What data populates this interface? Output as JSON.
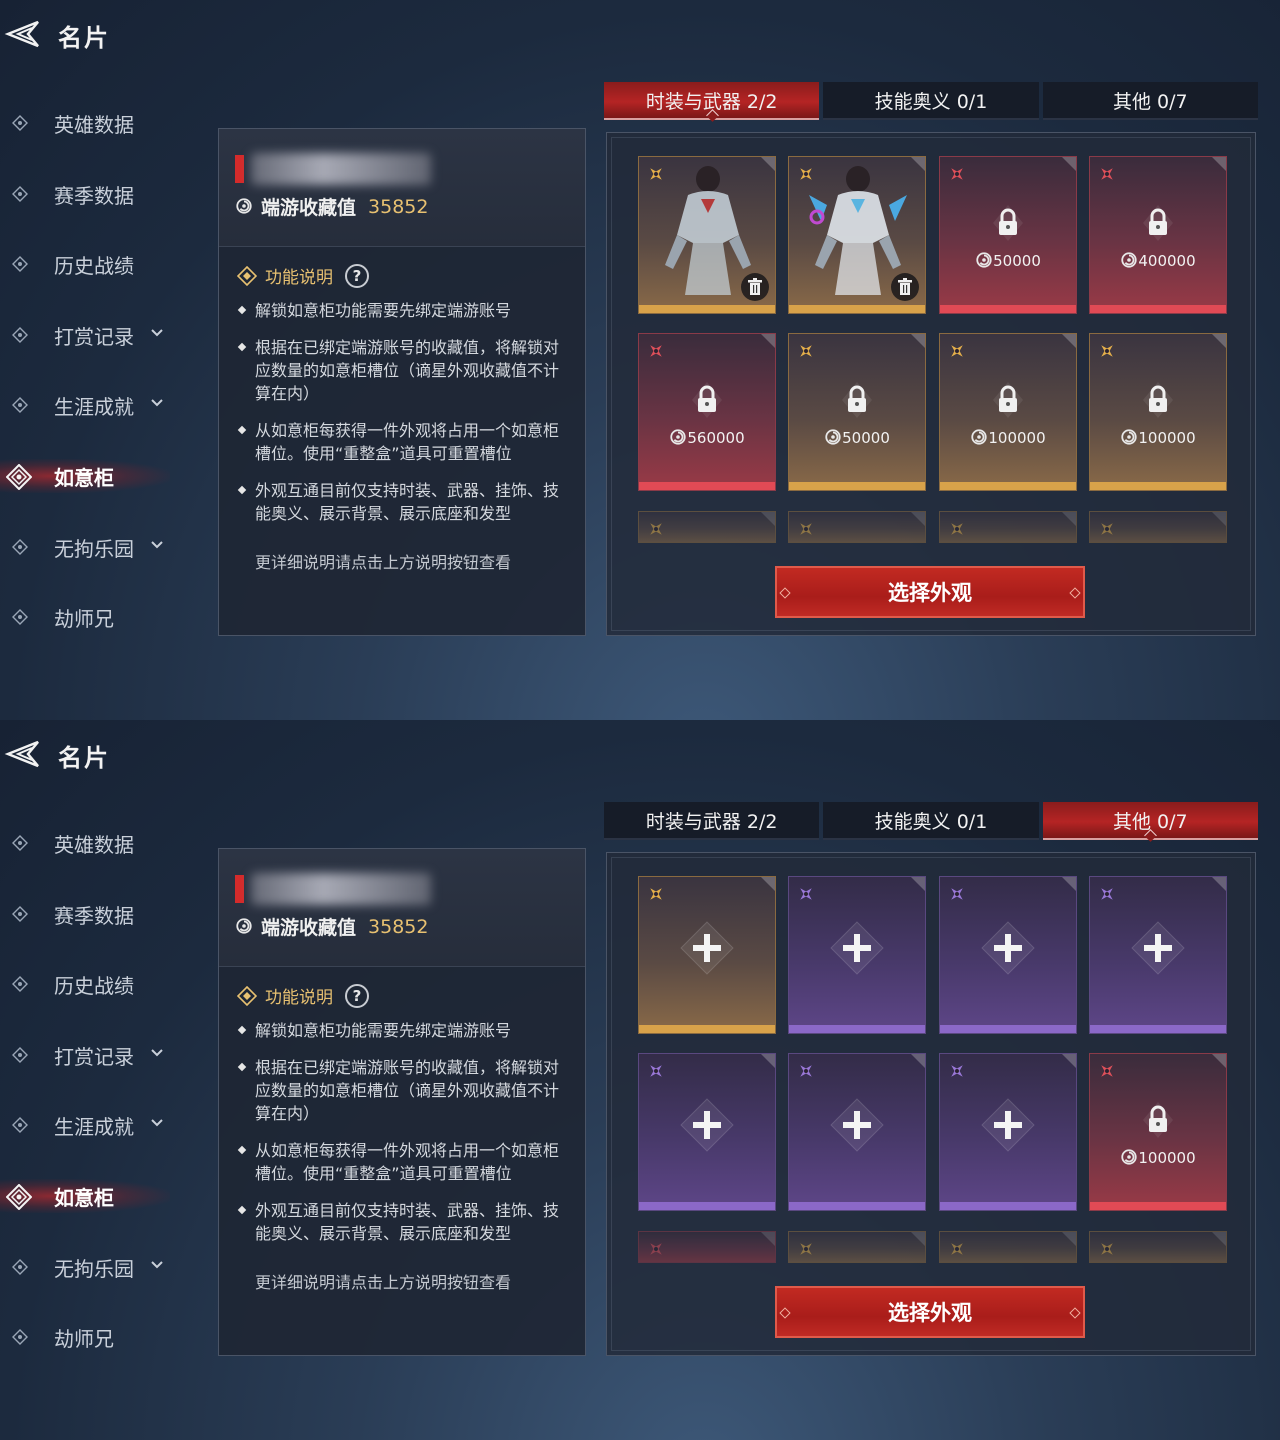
{
  "screens": [
    {
      "title": "名片",
      "nav": [
        {
          "label": "英雄数据",
          "chevron": false,
          "active": false
        },
        {
          "label": "赛季数据",
          "chevron": false,
          "active": false
        },
        {
          "label": "历史战绩",
          "chevron": false,
          "active": false
        },
        {
          "label": "打赏记录",
          "chevron": true,
          "active": false
        },
        {
          "label": "生涯成就",
          "chevron": true,
          "active": false
        },
        {
          "label": "如意柜",
          "chevron": false,
          "active": true
        },
        {
          "label": "无拘乐园",
          "chevron": true,
          "active": false
        },
        {
          "label": "劫师兄",
          "chevron": false,
          "active": false
        }
      ],
      "info": {
        "collect_label": "端游收藏值",
        "collect_value": "35852",
        "func_label": "功能说明",
        "help": "?",
        "bullets": [
          "解锁如意柜功能需要先绑定端游账号",
          "根据在已绑定端游账号的收藏值，将解锁对应数量的如意柜槽位（谪星外观收藏值不计算在内）",
          "从如意柜每获得一件外观将占用一个如意柜槽位。使用“重整盒”道具可重置槽位",
          "外观互通目前仅支持时装、武器、挂饰、技能奥义、展示背景、展示底座和发型"
        ],
        "note": "更详细说明请点击上方说明按钮查看"
      },
      "tabs": [
        {
          "label": "时装与武器 2/2",
          "active": true
        },
        {
          "label": "技能奥义  0/1",
          "active": false
        },
        {
          "label": "其他  0/7",
          "active": false
        }
      ],
      "slots": [
        {
          "rarity": "gold",
          "state": "item",
          "price": ""
        },
        {
          "rarity": "gold",
          "state": "item",
          "price": ""
        },
        {
          "rarity": "red",
          "state": "locked",
          "price": "50000"
        },
        {
          "rarity": "red",
          "state": "locked",
          "price": "400000"
        },
        {
          "rarity": "red",
          "state": "locked",
          "price": "560000"
        },
        {
          "rarity": "gold",
          "state": "locked",
          "price": "50000"
        },
        {
          "rarity": "gold",
          "state": "locked",
          "price": "100000"
        },
        {
          "rarity": "gold",
          "state": "locked",
          "price": "100000"
        }
      ],
      "peek_rarities": [
        "gold",
        "gold",
        "gold",
        "gold"
      ],
      "select_button": "选择外观"
    },
    {
      "title": "名片",
      "nav": [
        {
          "label": "英雄数据",
          "chevron": false,
          "active": false
        },
        {
          "label": "赛季数据",
          "chevron": false,
          "active": false
        },
        {
          "label": "历史战绩",
          "chevron": false,
          "active": false
        },
        {
          "label": "打赏记录",
          "chevron": true,
          "active": false
        },
        {
          "label": "生涯成就",
          "chevron": true,
          "active": false
        },
        {
          "label": "如意柜",
          "chevron": false,
          "active": true
        },
        {
          "label": "无拘乐园",
          "chevron": true,
          "active": false
        },
        {
          "label": "劫师兄",
          "chevron": false,
          "active": false
        }
      ],
      "info": {
        "collect_label": "端游收藏值",
        "collect_value": "35852",
        "func_label": "功能说明",
        "help": "?",
        "bullets": [
          "解锁如意柜功能需要先绑定端游账号",
          "根据在已绑定端游账号的收藏值，将解锁对应数量的如意柜槽位（谪星外观收藏值不计算在内）",
          "从如意柜每获得一件外观将占用一个如意柜槽位。使用“重整盒”道具可重置槽位",
          "外观互通目前仅支持时装、武器、挂饰、技能奥义、展示背景、展示底座和发型"
        ],
        "note": "更详细说明请点击上方说明按钮查看"
      },
      "tabs": [
        {
          "label": "时装与武器 2/2",
          "active": false
        },
        {
          "label": "技能奥义  0/1",
          "active": false
        },
        {
          "label": "其他  0/7",
          "active": true
        }
      ],
      "slots": [
        {
          "rarity": "gold",
          "state": "empty",
          "price": ""
        },
        {
          "rarity": "purple",
          "state": "empty",
          "price": ""
        },
        {
          "rarity": "purple",
          "state": "empty",
          "price": ""
        },
        {
          "rarity": "purple",
          "state": "empty",
          "price": ""
        },
        {
          "rarity": "purple",
          "state": "empty",
          "price": ""
        },
        {
          "rarity": "purple",
          "state": "empty",
          "price": ""
        },
        {
          "rarity": "purple",
          "state": "empty",
          "price": ""
        },
        {
          "rarity": "red",
          "state": "locked",
          "price": "100000"
        }
      ],
      "peek_rarities": [
        "red",
        "gold",
        "gold",
        "gold"
      ],
      "select_button": "选择外观"
    }
  ],
  "colors": {
    "accent_red": "#c22a22",
    "gold_text": "#e8c171",
    "rarity_gold": "#d8a24a",
    "rarity_red": "#e14a55",
    "rarity_purple": "#8b68c8"
  },
  "icons": [
    "back-arrow-icon",
    "nav-diamond-icon",
    "chevron-down-icon",
    "coin-icon",
    "function-diamond-icon",
    "lock-icon",
    "plus-icon",
    "trash-icon",
    "rarity-star-icon"
  ]
}
